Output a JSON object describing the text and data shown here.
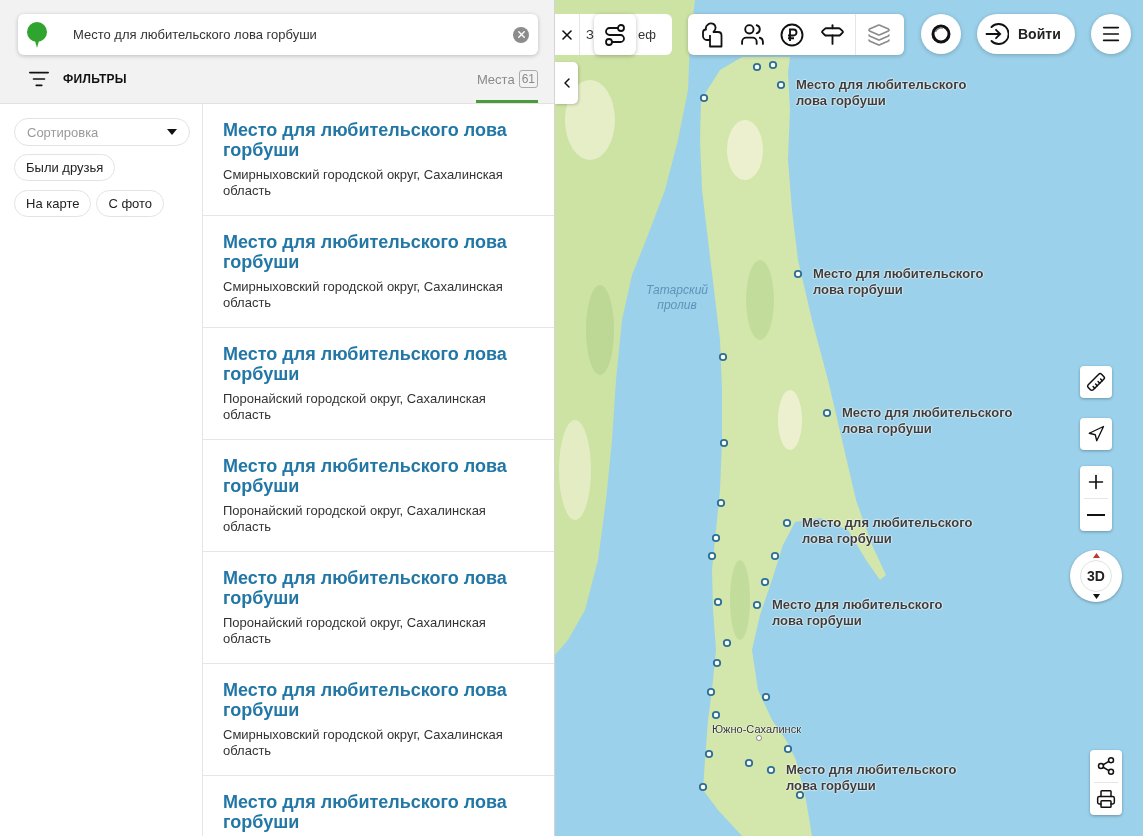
{
  "search": {
    "value": "Место для любительского лова горбуши"
  },
  "filters_button": {
    "label": "ФИЛЬТРЫ"
  },
  "tabs": [
    {
      "label": "Места",
      "count": "61",
      "selected": true
    }
  ],
  "sort": {
    "placeholder": "Сортировка"
  },
  "chips": [
    {
      "label": "Были друзья",
      "selected": false
    },
    {
      "label": "На карте",
      "selected": false
    },
    {
      "label": "С фото",
      "selected": false
    }
  ],
  "results": [
    {
      "title": "Место для любительского лова горбуши",
      "address": "Смирныховский городской округ, Сахалинская область"
    },
    {
      "title": "Место для любительского лова горбуши",
      "address": "Смирныховский городской округ, Сахалинская область"
    },
    {
      "title": "Место для любительского лова горбуши",
      "address": "Поронайский городской округ, Сахалинская область"
    },
    {
      "title": "Место для любительского лова горбуши",
      "address": "Поронайский городской округ, Сахалинская область"
    },
    {
      "title": "Место для любительского лова горбуши",
      "address": "Поронайский городской округ, Сахалинская область"
    },
    {
      "title": "Место для любительского лова горбуши",
      "address": "Смирныховский городской округ, Сахалинская область"
    },
    {
      "title": "Место для любительского лова горбуши"
    }
  ],
  "map": {
    "layer_chip": {
      "visible_start": "З",
      "visible_end": "еф"
    },
    "login_button": {
      "label": "Войти"
    },
    "compass": {
      "label": "3D"
    },
    "water_label": "Татарский пролив",
    "city_label": "Южно-Сахалинск",
    "place_labels": [
      "Место для любительского лова горбуши",
      "Место для любительского лова горбуши",
      "Место для любительского лова горбуши",
      "Место для любительского лова горбуши",
      "Место для любительского лова горбуши",
      "Место для любительского лова горбуши"
    ]
  }
}
